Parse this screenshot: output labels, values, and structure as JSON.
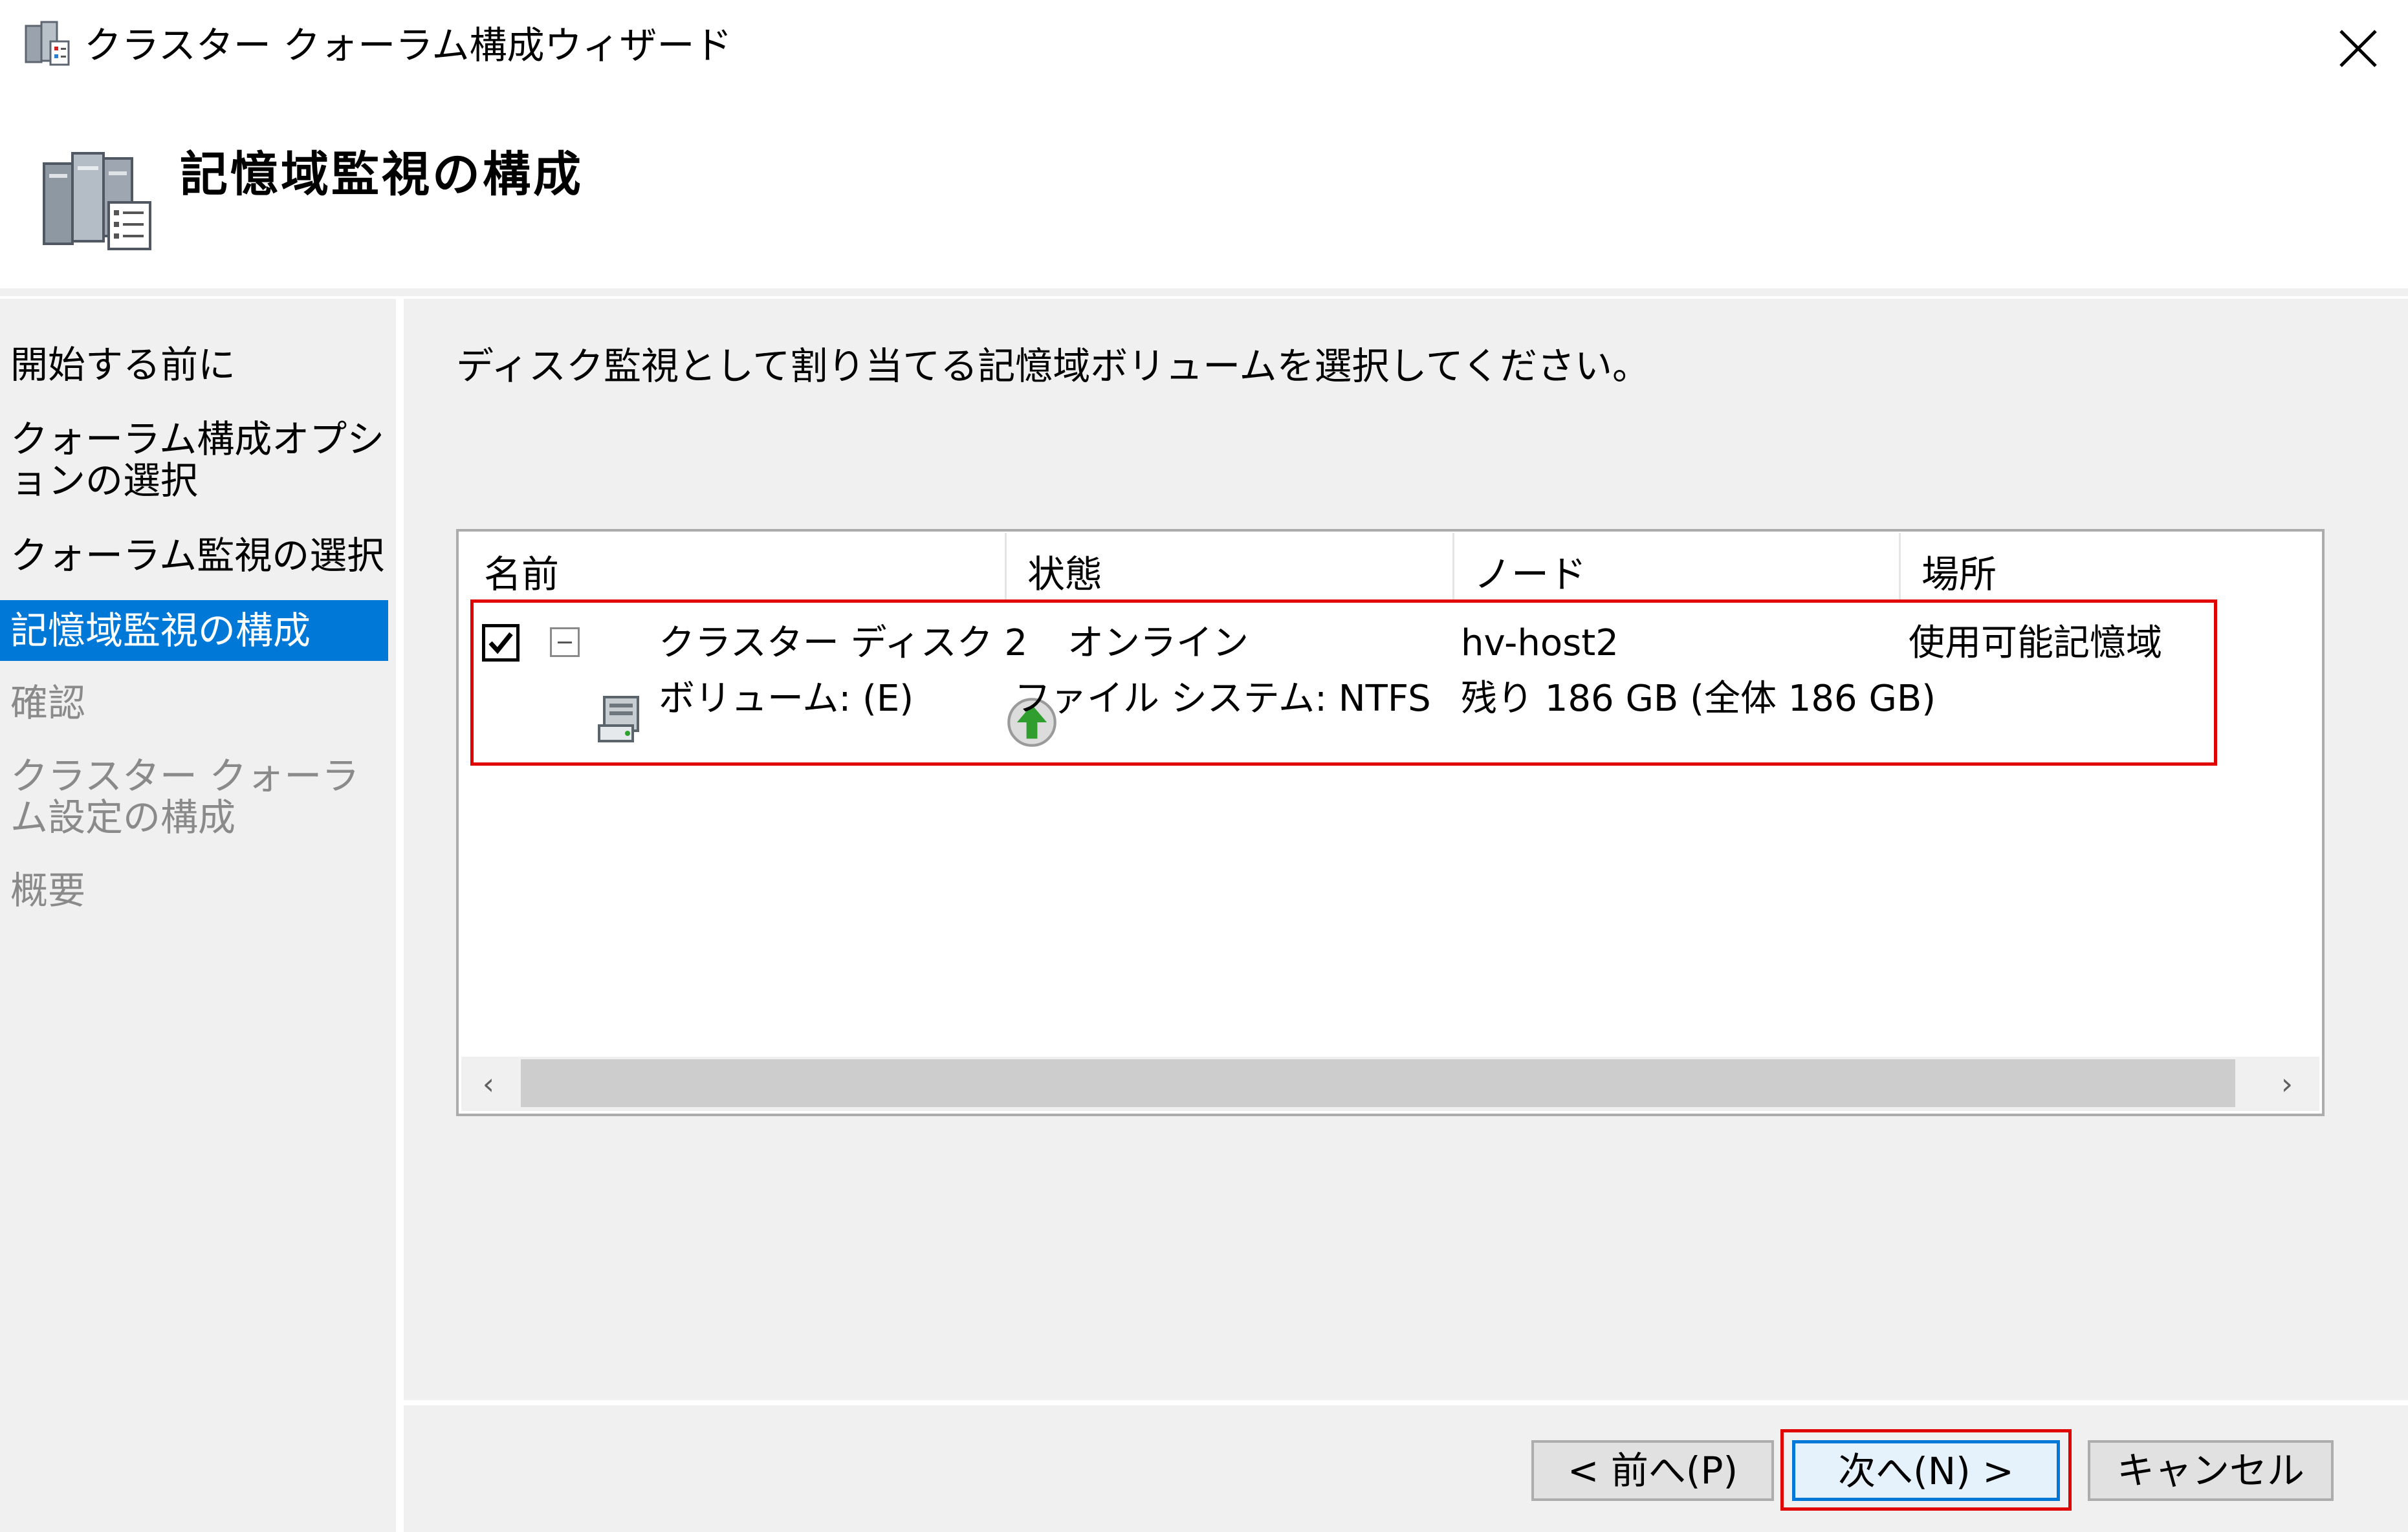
{
  "window": {
    "title": "クラスター クォーラム構成ウィザード",
    "close_glyph": "✕"
  },
  "header": {
    "page_title": "記憶域監視の構成"
  },
  "sidebar": {
    "items": [
      {
        "label": "開始する前に",
        "state": "enabled"
      },
      {
        "label": "クォーラム構成オプションの選択",
        "state": "enabled"
      },
      {
        "label": "クォーラム監視の選択",
        "state": "enabled"
      },
      {
        "label": "記憶域監視の構成",
        "state": "active"
      },
      {
        "label": "確認",
        "state": "disabled"
      },
      {
        "label": "クラスター クォーラム設定の構成",
        "state": "disabled"
      },
      {
        "label": "概要",
        "state": "disabled"
      }
    ]
  },
  "main": {
    "instruction": "ディスク監視として割り当てる記憶域ボリュームを選択してください。",
    "columns": [
      "名前",
      "状態",
      "ノード",
      "場所"
    ],
    "rows": [
      {
        "checked": true,
        "expanded": true,
        "name": "クラスター ディスク 2",
        "status": "オンライン",
        "node": "hv-host2",
        "location": "使用可能記憶域",
        "sub": {
          "name": "ボリューム: (E)",
          "status": "ファイル システム: NTFS",
          "node": "残り 186 GB (全体 186 GB)"
        }
      }
    ],
    "scroll_left": "‹",
    "scroll_right": "›"
  },
  "footer": {
    "prev_label": "< 前へ(P)",
    "next_label": "次へ(N) >",
    "cancel_label": "キャンセル"
  },
  "colors": {
    "accent": "#0078d7",
    "highlight_red": "#e00000",
    "panel_bg": "#f0f0f0"
  },
  "icons": [
    "cluster-wizard-icon",
    "storage-config-icon",
    "checkbox-checked-icon",
    "collapse-icon",
    "disk-volume-icon",
    "online-status-icon",
    "close-icon"
  ]
}
